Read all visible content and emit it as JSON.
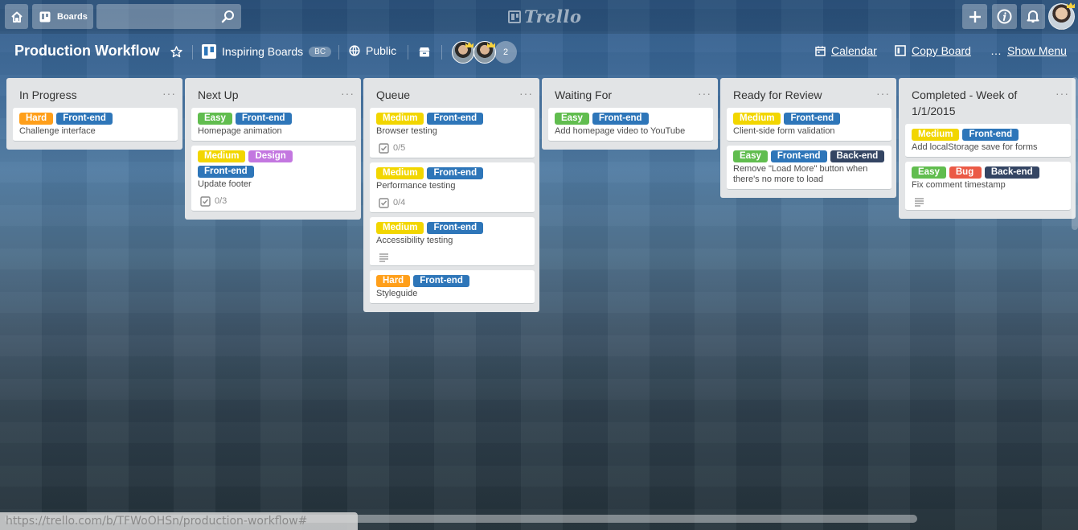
{
  "header": {
    "boards_label": "Boards",
    "search_placeholder": "",
    "logo_text": "Trello"
  },
  "board": {
    "title": "Production Workflow",
    "team": "Inspiring Boards",
    "team_badge": "BC",
    "visibility": "Public",
    "member_count": "2",
    "calendar": "Calendar",
    "copy_board": "Copy Board",
    "show_menu": "Show Menu"
  },
  "lists": [
    {
      "title": "In Progress",
      "cards": [
        {
          "labels": [
            {
              "text": "Hard",
              "color": "#ff9f1a"
            },
            {
              "text": "Front-end",
              "color": "#2e76b9"
            }
          ],
          "title": "Challenge interface"
        }
      ]
    },
    {
      "title": "Next Up",
      "cards": [
        {
          "labels": [
            {
              "text": "Easy",
              "color": "#61bd4f"
            },
            {
              "text": "Front-end",
              "color": "#2e76b9"
            }
          ],
          "title": "Homepage animation"
        },
        {
          "labels": [
            {
              "text": "Medium",
              "color": "#f2d600"
            },
            {
              "text": "Design",
              "color": "#c377e0"
            },
            {
              "text": "Front-end",
              "color": "#2e76b9"
            }
          ],
          "title": "Update footer",
          "checklist": "0/3"
        }
      ]
    },
    {
      "title": "Queue",
      "cards": [
        {
          "labels": [
            {
              "text": "Medium",
              "color": "#f2d600"
            },
            {
              "text": "Front-end",
              "color": "#2e76b9"
            }
          ],
          "title": "Browser testing",
          "checklist": "0/5"
        },
        {
          "labels": [
            {
              "text": "Medium",
              "color": "#f2d600"
            },
            {
              "text": "Front-end",
              "color": "#2e76b9"
            }
          ],
          "title": "Performance testing",
          "checklist": "0/4"
        },
        {
          "labels": [
            {
              "text": "Medium",
              "color": "#f2d600"
            },
            {
              "text": "Front-end",
              "color": "#2e76b9"
            }
          ],
          "title": "Accessibility testing",
          "description": true
        },
        {
          "labels": [
            {
              "text": "Hard",
              "color": "#ff9f1a"
            },
            {
              "text": "Front-end",
              "color": "#2e76b9"
            }
          ],
          "title": "Styleguide"
        }
      ]
    },
    {
      "title": "Waiting For",
      "cards": [
        {
          "labels": [
            {
              "text": "Easy",
              "color": "#61bd4f"
            },
            {
              "text": "Front-end",
              "color": "#2e76b9"
            }
          ],
          "title": "Add homepage video to YouTube"
        }
      ]
    },
    {
      "title": "Ready for Review",
      "cards": [
        {
          "labels": [
            {
              "text": "Medium",
              "color": "#f2d600"
            },
            {
              "text": "Front-end",
              "color": "#2e76b9"
            }
          ],
          "title": "Client-side form validation"
        },
        {
          "labels": [
            {
              "text": "Easy",
              "color": "#61bd4f"
            },
            {
              "text": "Front-end",
              "color": "#2e76b9"
            },
            {
              "text": "Back-end",
              "color": "#344563"
            }
          ],
          "title": "Remove \"Load More\" button when there's no more to load"
        }
      ]
    },
    {
      "title": "Completed - Week of 1/1/2015",
      "cards": [
        {
          "labels": [
            {
              "text": "Medium",
              "color": "#f2d600"
            },
            {
              "text": "Front-end",
              "color": "#2e76b9"
            }
          ],
          "title": "Add localStorage save for forms"
        },
        {
          "labels": [
            {
              "text": "Easy",
              "color": "#61bd4f"
            },
            {
              "text": "Bug",
              "color": "#eb5a46"
            },
            {
              "text": "Back-end",
              "color": "#344563"
            }
          ],
          "title": "Fix comment timestamp",
          "description": true
        }
      ]
    }
  ],
  "status_url": "https://trello.com/b/TFWoOHSn/production-workflow#"
}
